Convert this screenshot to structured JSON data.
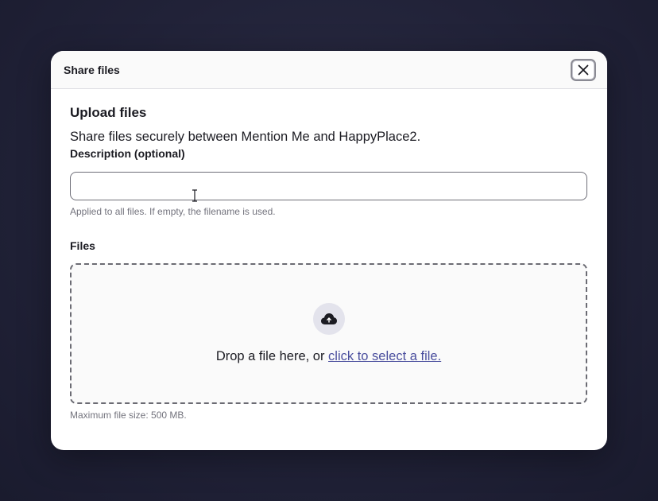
{
  "modal": {
    "title": "Share files",
    "close_icon": "close-icon"
  },
  "upload": {
    "section_title": "Upload files",
    "intro": "Share files securely between Mention Me and HappyPlace2.",
    "description_label": "Description (optional)",
    "description_value": "",
    "description_hint": "Applied to all files. If empty, the filename is used.",
    "files_label": "Files",
    "dropzone": {
      "icon": "cloud-upload-icon",
      "text": "Drop a file here, or ",
      "link": "click to select a file."
    },
    "max_size": "Maximum file size: 500 MB."
  },
  "colors": {
    "backdrop": "#212238",
    "link": "#4a4e9e",
    "hint_text": "#73737d"
  }
}
